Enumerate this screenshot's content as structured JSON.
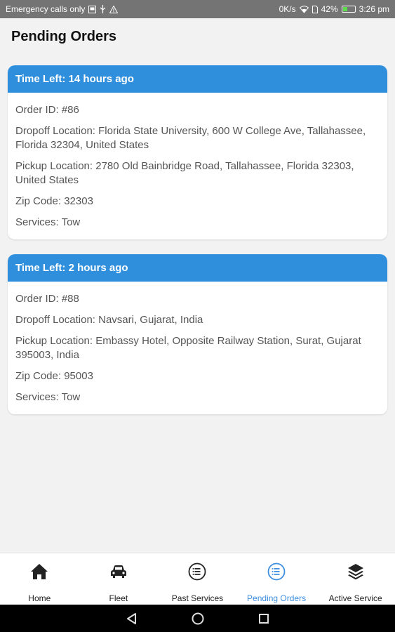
{
  "status_bar": {
    "left_text": "Emergency calls only",
    "network_speed": "0K/s",
    "battery_percent": "42%",
    "battery_level": 0.42,
    "time": "3:26 pm"
  },
  "page": {
    "title": "Pending Orders"
  },
  "orders": [
    {
      "time_left": "Time Left: 14 hours ago",
      "order_id": "Order ID: #86",
      "dropoff": "Dropoff Location: Florida State University, 600 W College Ave, Tallahassee, Florida 32304, United States",
      "pickup": "Pickup Location: 2780 Old Bainbridge Road, Tallahassee, Florida 32303, United States",
      "zip": "Zip Code: 32303",
      "services": "Services: Tow"
    },
    {
      "time_left": "Time Left: 2 hours ago",
      "order_id": "Order ID: #88",
      "dropoff": "Dropoff Location: Navsari, Gujarat, India",
      "pickup": "Pickup Location: Embassy Hotel, Opposite Railway Station, Surat, Gujarat 395003, India",
      "zip": "Zip Code: 95003",
      "services": "Services: Tow"
    }
  ],
  "bottom_nav": {
    "active_color": "#3f8fe0",
    "items": [
      {
        "label": "Home",
        "icon": "home-icon"
      },
      {
        "label": "Fleet",
        "icon": "car-icon"
      },
      {
        "label": "Past Services",
        "icon": "list-circle-icon"
      },
      {
        "label": "Pending Orders",
        "icon": "list-circle-icon",
        "active": true
      },
      {
        "label": "Active Service",
        "icon": "layers-icon"
      }
    ]
  },
  "colors": {
    "header_blue": "#2f8fdd",
    "status_bar": "#747474"
  }
}
